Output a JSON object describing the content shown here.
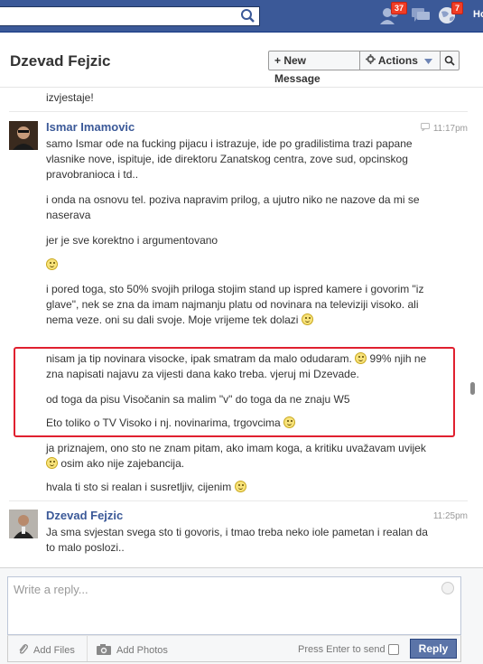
{
  "topbar": {
    "friend_requests_count": "37",
    "notifications_count": "7",
    "home_label": "Ho"
  },
  "header": {
    "title": "Dzevad Fejzic",
    "new_message_label": "+ New Message",
    "actions_label": "Actions"
  },
  "messages": {
    "prev_tail": "izvjestaje!",
    "blocks": [
      {
        "author": "Ismar Imamovic",
        "time": "11:17pm",
        "lines": [
          "samo Ismar ode na fucking pijacu i istrazuje, ide po gradilistima trazi papane vlasnike nove, ispituje, ide direktoru Zanatskog centra, zove sud, opcinskog pravobranioca i td..",
          "i onda na osnovu tel. poziva napravim prilog, a ujutro niko ne nazove da mi se naserava",
          "jer je sve korektno i argumentovano",
          "",
          "i pored toga, sto 50% svojih priloga stojim stand up ispred kamere i govorim \"iz glave\", nek se zna da imam najmanju platu od novinara na televiziji visoko. ali nema veze. oni su dali svoje.   Moje vrijeme tek dolazi",
          "nisam ja tip novinara visocke, ipak smatram da malo odudaram.",
          "99% njih ne zna napisati najavu za vijesti dana kako treba. vjeruj mi Dzevade.",
          "od toga da pisu Visočanin sa malim \"v\" do toga da ne znaju W5",
          "Eto toliko o TV Visoko i nj. novinarima, trgovcima",
          "ja priznajem, ono sto ne znam pitam, ako imam koga, a kritiku uvažavam uvijek",
          "osim ako nije zajebancija.",
          "hvala ti sto si realan i susretljiv, cijenim"
        ]
      },
      {
        "author": "Dzevad Fejzic",
        "time": "11:25pm",
        "lines": [
          "Ja sma svjestan svega sto ti govoris, i tmao treba neko iole pametan i realan da to malo poslozi.."
        ]
      }
    ]
  },
  "composer": {
    "placeholder": "Write a reply...",
    "add_files_label": "Add Files",
    "add_photos_label": "Add Photos",
    "press_enter_label": "Press Enter to send",
    "reply_label": "Reply"
  },
  "colors": {
    "brand": "#3b5998",
    "badge": "#f03d25",
    "highlight": "#e0202f"
  }
}
